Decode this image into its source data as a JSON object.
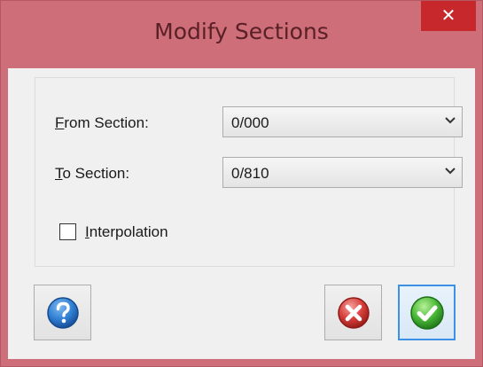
{
  "window": {
    "title": "Modify Sections",
    "close_glyph": "✕"
  },
  "form": {
    "from_section": {
      "label_accesskey": "F",
      "label_rest": "rom Section:",
      "value": "0/000"
    },
    "to_section": {
      "label_accesskey": "T",
      "label_rest": "o Section:",
      "value": "0/810"
    },
    "interpolation": {
      "label_accesskey": "I",
      "label_rest": "nterpolation",
      "checked": false
    }
  },
  "buttons": {
    "help_icon": "help-icon",
    "cancel_icon": "cancel-icon",
    "ok_icon": "ok-checkmark-icon"
  },
  "colors": {
    "title_bar": "#cd6e78",
    "close_button": "#c7282c",
    "client_bg": "#f0f0f0",
    "default_button_border": "#3c91e6"
  }
}
